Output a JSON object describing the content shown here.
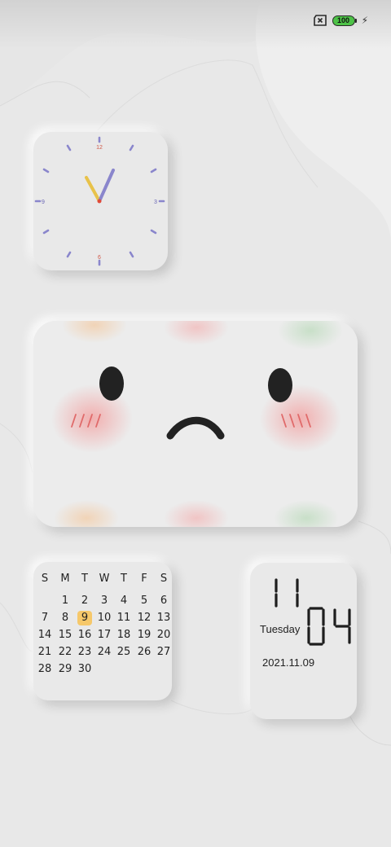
{
  "status_bar": {
    "battery_level": "100",
    "sim_icon": "no-sim-icon",
    "charging_icon": "bolt-icon",
    "battery_color": "#4dc247"
  },
  "clock": {
    "numerals": {
      "top": "12",
      "right": "3",
      "bottom": "6",
      "left": "9"
    },
    "hour_hand_color": "#e8c24a",
    "minute_hand_color": "#8a86cc",
    "tick_color": "#8a86cc",
    "numeral_12_6_color": "#d05a4a"
  },
  "face_widget": {
    "expression": "sad",
    "blush_color": "#f2a4a4"
  },
  "calendar": {
    "weekdays": [
      "S",
      "M",
      "T",
      "W",
      "T",
      "F",
      "S"
    ],
    "weeks": [
      [
        "",
        "1",
        "2",
        "3",
        "4",
        "5",
        "6"
      ],
      [
        "7",
        "8",
        "9",
        "10",
        "11",
        "12",
        "13"
      ],
      [
        "14",
        "15",
        "16",
        "17",
        "18",
        "19",
        "20"
      ],
      [
        "21",
        "22",
        "23",
        "24",
        "25",
        "26",
        "27"
      ],
      [
        "28",
        "29",
        "30",
        "",
        "",
        "",
        ""
      ]
    ],
    "today": "9",
    "highlight_color": "#f6c86a"
  },
  "digital_clock": {
    "hour": "11",
    "minute": "04",
    "weekday": "Tuesday",
    "date": "2021.11.09"
  }
}
